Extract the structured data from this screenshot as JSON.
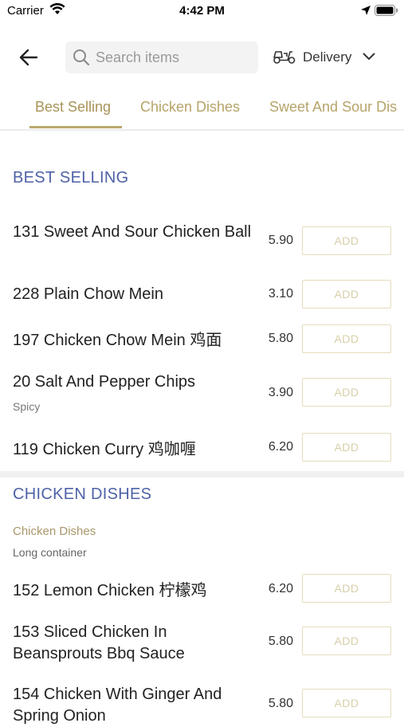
{
  "status_bar": {
    "carrier": "Carrier",
    "time": "4:42 PM"
  },
  "header": {
    "search": {
      "placeholder": "Search items",
      "value": ""
    },
    "delivery_label": "Delivery"
  },
  "tabs": [
    {
      "label": "Best Selling",
      "active": true
    },
    {
      "label": "Chicken Dishes",
      "active": false
    },
    {
      "label": "Sweet And Sour Dis",
      "active": false
    }
  ],
  "sections": {
    "best_selling": {
      "title": "BEST SELLING",
      "items": [
        {
          "name": "131 Sweet And Sour Chicken Ball",
          "price": "5.90",
          "add": "ADD"
        },
        {
          "name": "228 Plain Chow Mein",
          "price": "3.10",
          "add": "ADD"
        },
        {
          "name": "197 Chicken Chow Mein 鸡面",
          "price": "5.80",
          "add": "ADD"
        },
        {
          "name": "20 Salt And Pepper Chips",
          "sub": "Spicy",
          "price": "3.90",
          "add": "ADD"
        },
        {
          "name": "119 Chicken Curry 鸡咖喱",
          "price": "6.20",
          "add": "ADD"
        }
      ]
    },
    "chicken_dishes": {
      "title": "CHICKEN DISHES",
      "category_label": "Chicken Dishes",
      "category_desc": "Long container",
      "items": [
        {
          "name": "152 Lemon Chicken 柠檬鸡",
          "price": "6.20",
          "add": "ADD"
        },
        {
          "name": "153 Sliced Chicken In Beansprouts Bbq Sauce",
          "price": "5.80",
          "add": "ADD"
        },
        {
          "name": "154 Chicken With Ginger And Spring Onion",
          "price": "5.80",
          "add": "ADD"
        }
      ]
    }
  },
  "colors": {
    "accent_gold": "#bca96d",
    "section_blue": "#4e62a7",
    "add_border": "#e5dcbd"
  },
  "icons": [
    "wifi-icon",
    "location-arrow-icon",
    "battery-icon",
    "back-arrow-icon",
    "search-icon",
    "scooter-icon",
    "chevron-down-icon"
  ]
}
